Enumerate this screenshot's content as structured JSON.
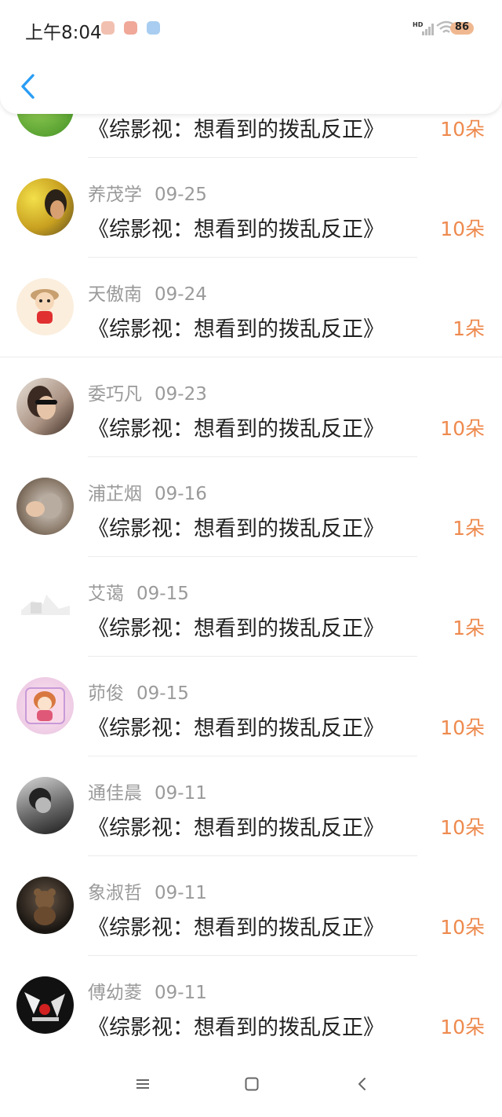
{
  "status_bar": {
    "time": "上午8:04",
    "battery": "86",
    "notification_colors": [
      "#e89a80",
      "#e07a6a",
      "#5aa0e0"
    ]
  },
  "header": {
    "back_icon": "chevron-left-icon",
    "accent": "#2a9df4"
  },
  "colors": {
    "amount": "#ee8a4e",
    "meta": "#9a9a9a",
    "title": "#222222"
  },
  "partial_row": {
    "title": "《综影视：想看到的拨乱反正》",
    "amount": "10朵"
  },
  "rows": [
    {
      "name": "养茂学",
      "date": "09-25",
      "title": "《综影视：想看到的拨乱反正》",
      "amount": "10朵"
    },
    {
      "name": "天傲南",
      "date": "09-24",
      "title": "《综影视：想看到的拨乱反正》",
      "amount": "1朵"
    },
    {
      "name": "委巧凡",
      "date": "09-23",
      "title": "《综影视：想看到的拨乱反正》",
      "amount": "10朵"
    },
    {
      "name": "浦芷烟",
      "date": "09-16",
      "title": "《综影视：想看到的拨乱反正》",
      "amount": "1朵"
    },
    {
      "name": "艾蔼",
      "date": "09-15",
      "title": "《综影视：想看到的拨乱反正》",
      "amount": "1朵"
    },
    {
      "name": "茆俊",
      "date": "09-15",
      "title": "《综影视：想看到的拨乱反正》",
      "amount": "10朵"
    },
    {
      "name": "通佳晨",
      "date": "09-11",
      "title": "《综影视：想看到的拨乱反正》",
      "amount": "10朵"
    },
    {
      "name": "象淑哲",
      "date": "09-11",
      "title": "《综影视：想看到的拨乱反正》",
      "amount": "10朵"
    },
    {
      "name": "傅幼菱",
      "date": "09-11",
      "title": "《综影视：想看到的拨乱反正》",
      "amount": "10朵"
    }
  ],
  "nav": {
    "menu_icon": "menu-icon",
    "home_icon": "home-square-icon",
    "back_icon": "back-triangle-icon"
  }
}
